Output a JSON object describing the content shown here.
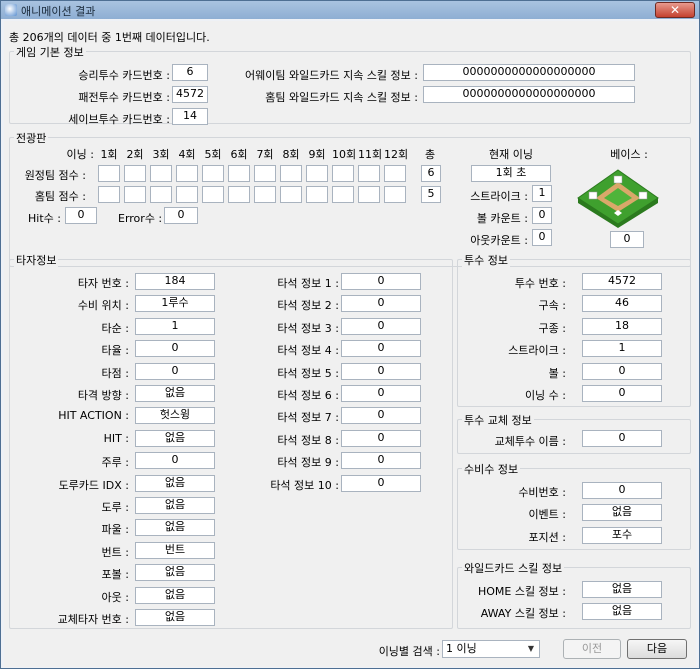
{
  "window": {
    "title": "애니메이션 결과",
    "close_label": "✕"
  },
  "summary": "총 206개의 데이터 중 1번째 데이터입니다.",
  "basic": {
    "title": "게임 기본 정보",
    "win_pitcher_label": "승리투수 카드번호 :",
    "win_pitcher": "6",
    "lose_pitcher_label": "패전투수 카드번호 :",
    "lose_pitcher": "4572",
    "save_pitcher_label": "세이브투수 카드번호 :",
    "save_pitcher": "14",
    "away_wild_label": "어웨이팀 와일드카드 지속 스킬 정보 :",
    "away_wild": "0000000000000000000",
    "home_wild_label": "홈팀 와일드카드 지속 스킬 정보 :",
    "home_wild": "0000000000000000000"
  },
  "board": {
    "title": "전광판",
    "inning_label": "이닝 :",
    "innings": [
      "1회",
      "2회",
      "3회",
      "4회",
      "5회",
      "6회",
      "7회",
      "8회",
      "9회",
      "10회",
      "11회",
      "12회"
    ],
    "total_label": "총",
    "away_label": "원정팀 점수 :",
    "home_label": "홈팀 점수 :",
    "away_total": "6",
    "home_total": "5",
    "hit_label": "Hit수 :",
    "hit": "0",
    "error_label": "Error수 :",
    "error": "0",
    "current_inning_label": "현재 이닝",
    "current_inning": "1회 초",
    "strike_label": "스트라이크 :",
    "strike": "1",
    "ball_label": "볼 카운트 :",
    "ball": "0",
    "out_label": "아웃카운트 :",
    "out": "0",
    "base_label": "베이스 :",
    "base": "0"
  },
  "batter": {
    "title": "타자정보",
    "rows": [
      {
        "label": "타자 번호 :",
        "value": "184"
      },
      {
        "label": "수비 위치 :",
        "value": "1루수"
      },
      {
        "label": "타순 :",
        "value": "1"
      },
      {
        "label": "타율 :",
        "value": "0"
      },
      {
        "label": "타점 :",
        "value": "0"
      },
      {
        "label": "타격 방향 :",
        "value": "없음"
      },
      {
        "label": "HIT ACTION :",
        "value": "헛스윙"
      },
      {
        "label": "HIT :",
        "value": "없음"
      },
      {
        "label": "주루 :",
        "value": "0"
      },
      {
        "label": "도루카드 IDX :",
        "value": "없음"
      },
      {
        "label": "도루 :",
        "value": "없음"
      },
      {
        "label": "파울 :",
        "value": "없음"
      },
      {
        "label": "번트 :",
        "value": "번트"
      },
      {
        "label": "포볼 :",
        "value": "없음"
      },
      {
        "label": "아웃 :",
        "value": "없음"
      },
      {
        "label": "교체타자 번호 :",
        "value": "없음"
      }
    ],
    "at_bat": [
      {
        "label": "타석 정보  1 :",
        "value": "0"
      },
      {
        "label": "타석 정보  2 :",
        "value": "0"
      },
      {
        "label": "타석 정보  3 :",
        "value": "0"
      },
      {
        "label": "타석 정보  4 :",
        "value": "0"
      },
      {
        "label": "타석 정보  5 :",
        "value": "0"
      },
      {
        "label": "타석 정보  6 :",
        "value": "0"
      },
      {
        "label": "타석 정보  7 :",
        "value": "0"
      },
      {
        "label": "타석 정보  8 :",
        "value": "0"
      },
      {
        "label": "타석 정보  9 :",
        "value": "0"
      },
      {
        "label": "타석 정보 10 :",
        "value": "0"
      }
    ]
  },
  "pitcher": {
    "title": "투수 정보",
    "rows": [
      {
        "label": "투수 번호 :",
        "value": "4572"
      },
      {
        "label": "구속 :",
        "value": "46"
      },
      {
        "label": "구종 :",
        "value": "18"
      },
      {
        "label": "스트라이크 :",
        "value": "1"
      },
      {
        "label": "볼 :",
        "value": "0"
      },
      {
        "label": "이닝 수 :",
        "value": "0"
      }
    ]
  },
  "relief": {
    "title": "투수 교체 정보",
    "label": "교체투수 이름 :",
    "value": "0"
  },
  "fielder": {
    "title": "수비수 정보",
    "rows": [
      {
        "label": "수비번호 :",
        "value": "0"
      },
      {
        "label": "이벤트 :",
        "value": "없음"
      },
      {
        "label": "포지션 :",
        "value": "포수"
      }
    ]
  },
  "wildcard": {
    "title": "와일드카드 스킬 정보",
    "rows": [
      {
        "label": "HOME 스킬 정보 :",
        "value": "없음"
      },
      {
        "label": "AWAY 스킬 정보 :",
        "value": "없음"
      }
    ]
  },
  "footer": {
    "search_label": "이닝별 검색 :",
    "inning_select": "1 이닝",
    "prev_label": "이전",
    "next_label": "다음"
  }
}
